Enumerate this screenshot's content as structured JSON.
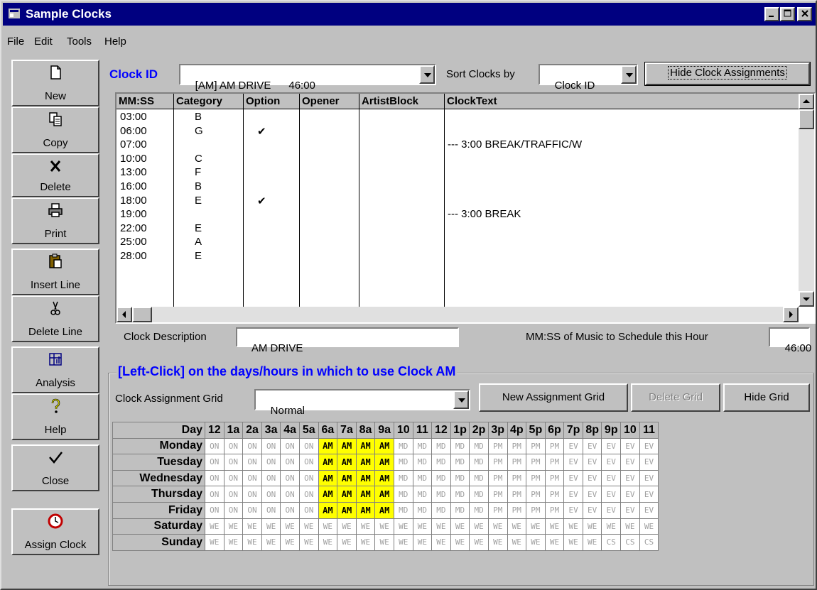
{
  "window": {
    "title": "Sample Clocks",
    "min": "_",
    "max": "□",
    "close": "X"
  },
  "menu": [
    {
      "label": "File",
      "u": "F"
    },
    {
      "label": "Edit",
      "u": "E"
    },
    {
      "label": "Tools",
      "u": "T"
    },
    {
      "label": "Help",
      "u": "H"
    }
  ],
  "toolbar": [
    {
      "label": "New",
      "icon": "new-document-icon"
    },
    {
      "label": "Copy",
      "icon": "copy-icon"
    },
    {
      "label": "Delete",
      "icon": "delete-x-icon"
    },
    {
      "label": "Print",
      "icon": "printer-icon"
    },
    {
      "label": "Insert Line",
      "icon": "clipboard-icon"
    },
    {
      "label": "Delete Line",
      "icon": "scissors-icon"
    },
    {
      "label": "Analysis",
      "icon": "analysis-icon"
    },
    {
      "label": "Help",
      "icon": "help-icon"
    },
    {
      "label": "Close",
      "icon": "checkmark-icon"
    },
    {
      "label": "Assign Clock",
      "icon": "clock-icon"
    }
  ],
  "clock": {
    "id_label": "Clock ID",
    "id_value": "[AM] AM DRIVE      46:00",
    "sort_label": "Sort Clocks by",
    "sort_value": "Clock ID",
    "hide_assign_button": "Hide Clock Assignments"
  },
  "table": {
    "headers": [
      "MM:SS",
      "Category",
      "Option",
      "Opener",
      "ArtistBlock",
      "ClockText"
    ],
    "rows": [
      {
        "time": "03:00",
        "category": "B",
        "option": "",
        "text": ""
      },
      {
        "time": "06:00",
        "category": "G",
        "option": "✔",
        "text": ""
      },
      {
        "time": "07:00",
        "category": "",
        "option": "",
        "text": "--- 3:00 BREAK/TRAFFIC/W"
      },
      {
        "time": "10:00",
        "category": "C",
        "option": "",
        "text": ""
      },
      {
        "time": "13:00",
        "category": "F",
        "option": "",
        "text": ""
      },
      {
        "time": "16:00",
        "category": "B",
        "option": "",
        "text": ""
      },
      {
        "time": "18:00",
        "category": "E",
        "option": "✔",
        "text": ""
      },
      {
        "time": "19:00",
        "category": "",
        "option": "",
        "text": "--- 3:00 BREAK"
      },
      {
        "time": "22:00",
        "category": "E",
        "option": "",
        "text": ""
      },
      {
        "time": "25:00",
        "category": "A",
        "option": "",
        "text": ""
      },
      {
        "time": "28:00",
        "category": "E",
        "option": "",
        "text": ""
      }
    ]
  },
  "description": {
    "label": "Clock Description",
    "value": "AM DRIVE",
    "mmss_label": "MM:SS of Music to Schedule this Hour",
    "mmss_value": "46:00"
  },
  "assign": {
    "group_title": "[Left-Click] on the days/hours in which to use Clock AM",
    "grid_label": "Clock Assignment Grid",
    "grid_value": "Normal",
    "new_grid_button": "New Assignment Grid",
    "delete_grid_button": "Delete Grid",
    "hide_grid_button": "Hide Grid"
  },
  "grid": {
    "corner": "Day",
    "hours": [
      "12",
      "1a",
      "2a",
      "3a",
      "4a",
      "5a",
      "6a",
      "7a",
      "8a",
      "9a",
      "10",
      "11",
      "12",
      "1p",
      "2p",
      "3p",
      "4p",
      "5p",
      "6p",
      "7p",
      "8p",
      "9p",
      "10",
      "11"
    ],
    "days": [
      {
        "name": "Monday",
        "cells": [
          "ON",
          "ON",
          "ON",
          "ON",
          "ON",
          "ON",
          "AM",
          "AM",
          "AM",
          "AM",
          "MD",
          "MD",
          "MD",
          "MD",
          "MD",
          "PM",
          "PM",
          "PM",
          "PM",
          "EV",
          "EV",
          "EV",
          "EV",
          "EV"
        ]
      },
      {
        "name": "Tuesday",
        "cells": [
          "ON",
          "ON",
          "ON",
          "ON",
          "ON",
          "ON",
          "AM",
          "AM",
          "AM",
          "AM",
          "MD",
          "MD",
          "MD",
          "MD",
          "MD",
          "PM",
          "PM",
          "PM",
          "PM",
          "EV",
          "EV",
          "EV",
          "EV",
          "EV"
        ]
      },
      {
        "name": "Wednesday",
        "cells": [
          "ON",
          "ON",
          "ON",
          "ON",
          "ON",
          "ON",
          "AM",
          "AM",
          "AM",
          "AM",
          "MD",
          "MD",
          "MD",
          "MD",
          "MD",
          "PM",
          "PM",
          "PM",
          "PM",
          "EV",
          "EV",
          "EV",
          "EV",
          "EV"
        ]
      },
      {
        "name": "Thursday",
        "cells": [
          "ON",
          "ON",
          "ON",
          "ON",
          "ON",
          "ON",
          "AM",
          "AM",
          "AM",
          "AM",
          "MD",
          "MD",
          "MD",
          "MD",
          "MD",
          "PM",
          "PM",
          "PM",
          "PM",
          "EV",
          "EV",
          "EV",
          "EV",
          "EV"
        ]
      },
      {
        "name": "Friday",
        "cells": [
          "ON",
          "ON",
          "ON",
          "ON",
          "ON",
          "ON",
          "AM",
          "AM",
          "AM",
          "AM",
          "MD",
          "MD",
          "MD",
          "MD",
          "MD",
          "PM",
          "PM",
          "PM",
          "PM",
          "EV",
          "EV",
          "EV",
          "EV",
          "EV"
        ]
      },
      {
        "name": "Saturday",
        "cells": [
          "WE",
          "WE",
          "WE",
          "WE",
          "WE",
          "WE",
          "WE",
          "WE",
          "WE",
          "WE",
          "WE",
          "WE",
          "WE",
          "WE",
          "WE",
          "WE",
          "WE",
          "WE",
          "WE",
          "WE",
          "WE",
          "WE",
          "WE",
          "WE"
        ]
      },
      {
        "name": "Sunday",
        "cells": [
          "WE",
          "WE",
          "WE",
          "WE",
          "WE",
          "WE",
          "WE",
          "WE",
          "WE",
          "WE",
          "WE",
          "WE",
          "WE",
          "WE",
          "WE",
          "WE",
          "WE",
          "WE",
          "WE",
          "WE",
          "WE",
          "CS",
          "CS",
          "CS"
        ]
      }
    ]
  },
  "colors": {
    "titlebar": "#000080",
    "label_blue": "#0000ff",
    "highlight": "#ffff00",
    "face": "#c0c0c0"
  }
}
